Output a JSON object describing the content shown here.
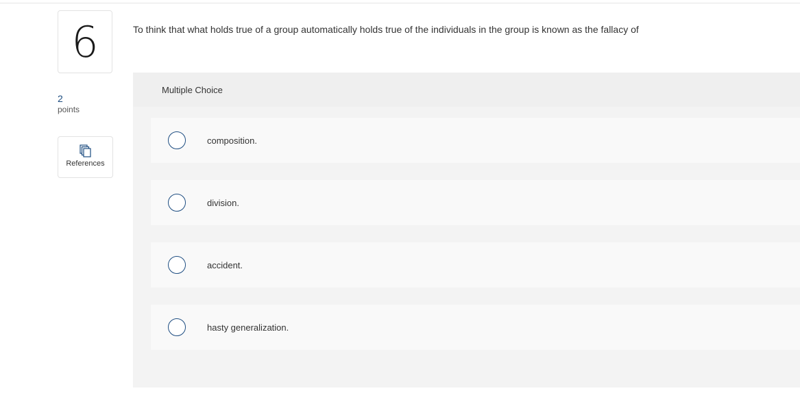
{
  "question": {
    "number": "6",
    "points_value": "2",
    "points_label": "points",
    "references_label": "References",
    "prompt": "To think that what holds true of a group automatically holds true of the individuals in the group is known as the fallacy of",
    "type_label": "Multiple Choice"
  },
  "choices": [
    {
      "label": "composition."
    },
    {
      "label": "division."
    },
    {
      "label": "accident."
    },
    {
      "label": "hasty generalization."
    }
  ],
  "icons": {
    "references": "copy-pages-icon",
    "radio": "radio-unselected-icon"
  },
  "colors": {
    "accent": "#1c4c80",
    "panel_bg": "#f2f2f2",
    "choice_bg": "#f9f9f9"
  }
}
